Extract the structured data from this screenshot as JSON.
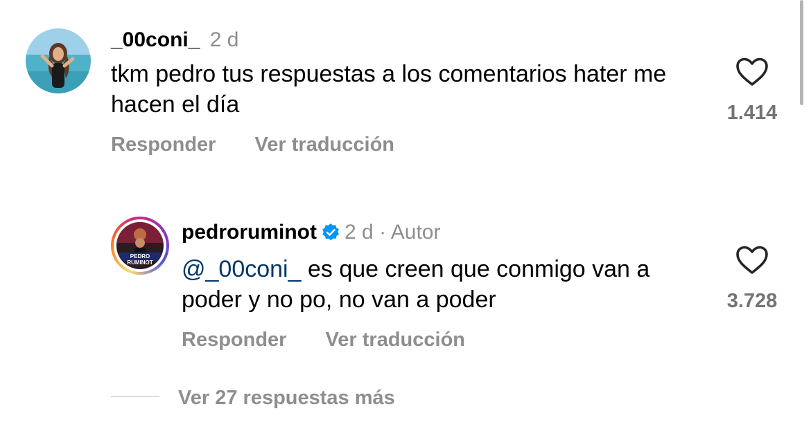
{
  "comment": {
    "username": "_00coni_",
    "time": "2 d",
    "text": "tkm pedro tus respuestas a los comentarios hater me hacen el día",
    "like_count": "1.414",
    "reply_label": "Responder",
    "translate_label": "Ver traducción"
  },
  "reply": {
    "username": "pedroruminot",
    "verified": true,
    "time": "2 d",
    "separator": "·",
    "author_badge": "Autor",
    "mention": "@_00coni_",
    "text": " es que creen que conmigo van a poder y no po, no van a poder",
    "like_count": "3.728",
    "reply_label": "Responder",
    "translate_label": "Ver traducción",
    "avatar_text": "PEDRO RUMINOT"
  },
  "view_more_label": "Ver 27 respuestas más",
  "colors": {
    "secondary_text": "#8e8e8e",
    "mention": "#00376b",
    "verified": "#0095f6"
  }
}
